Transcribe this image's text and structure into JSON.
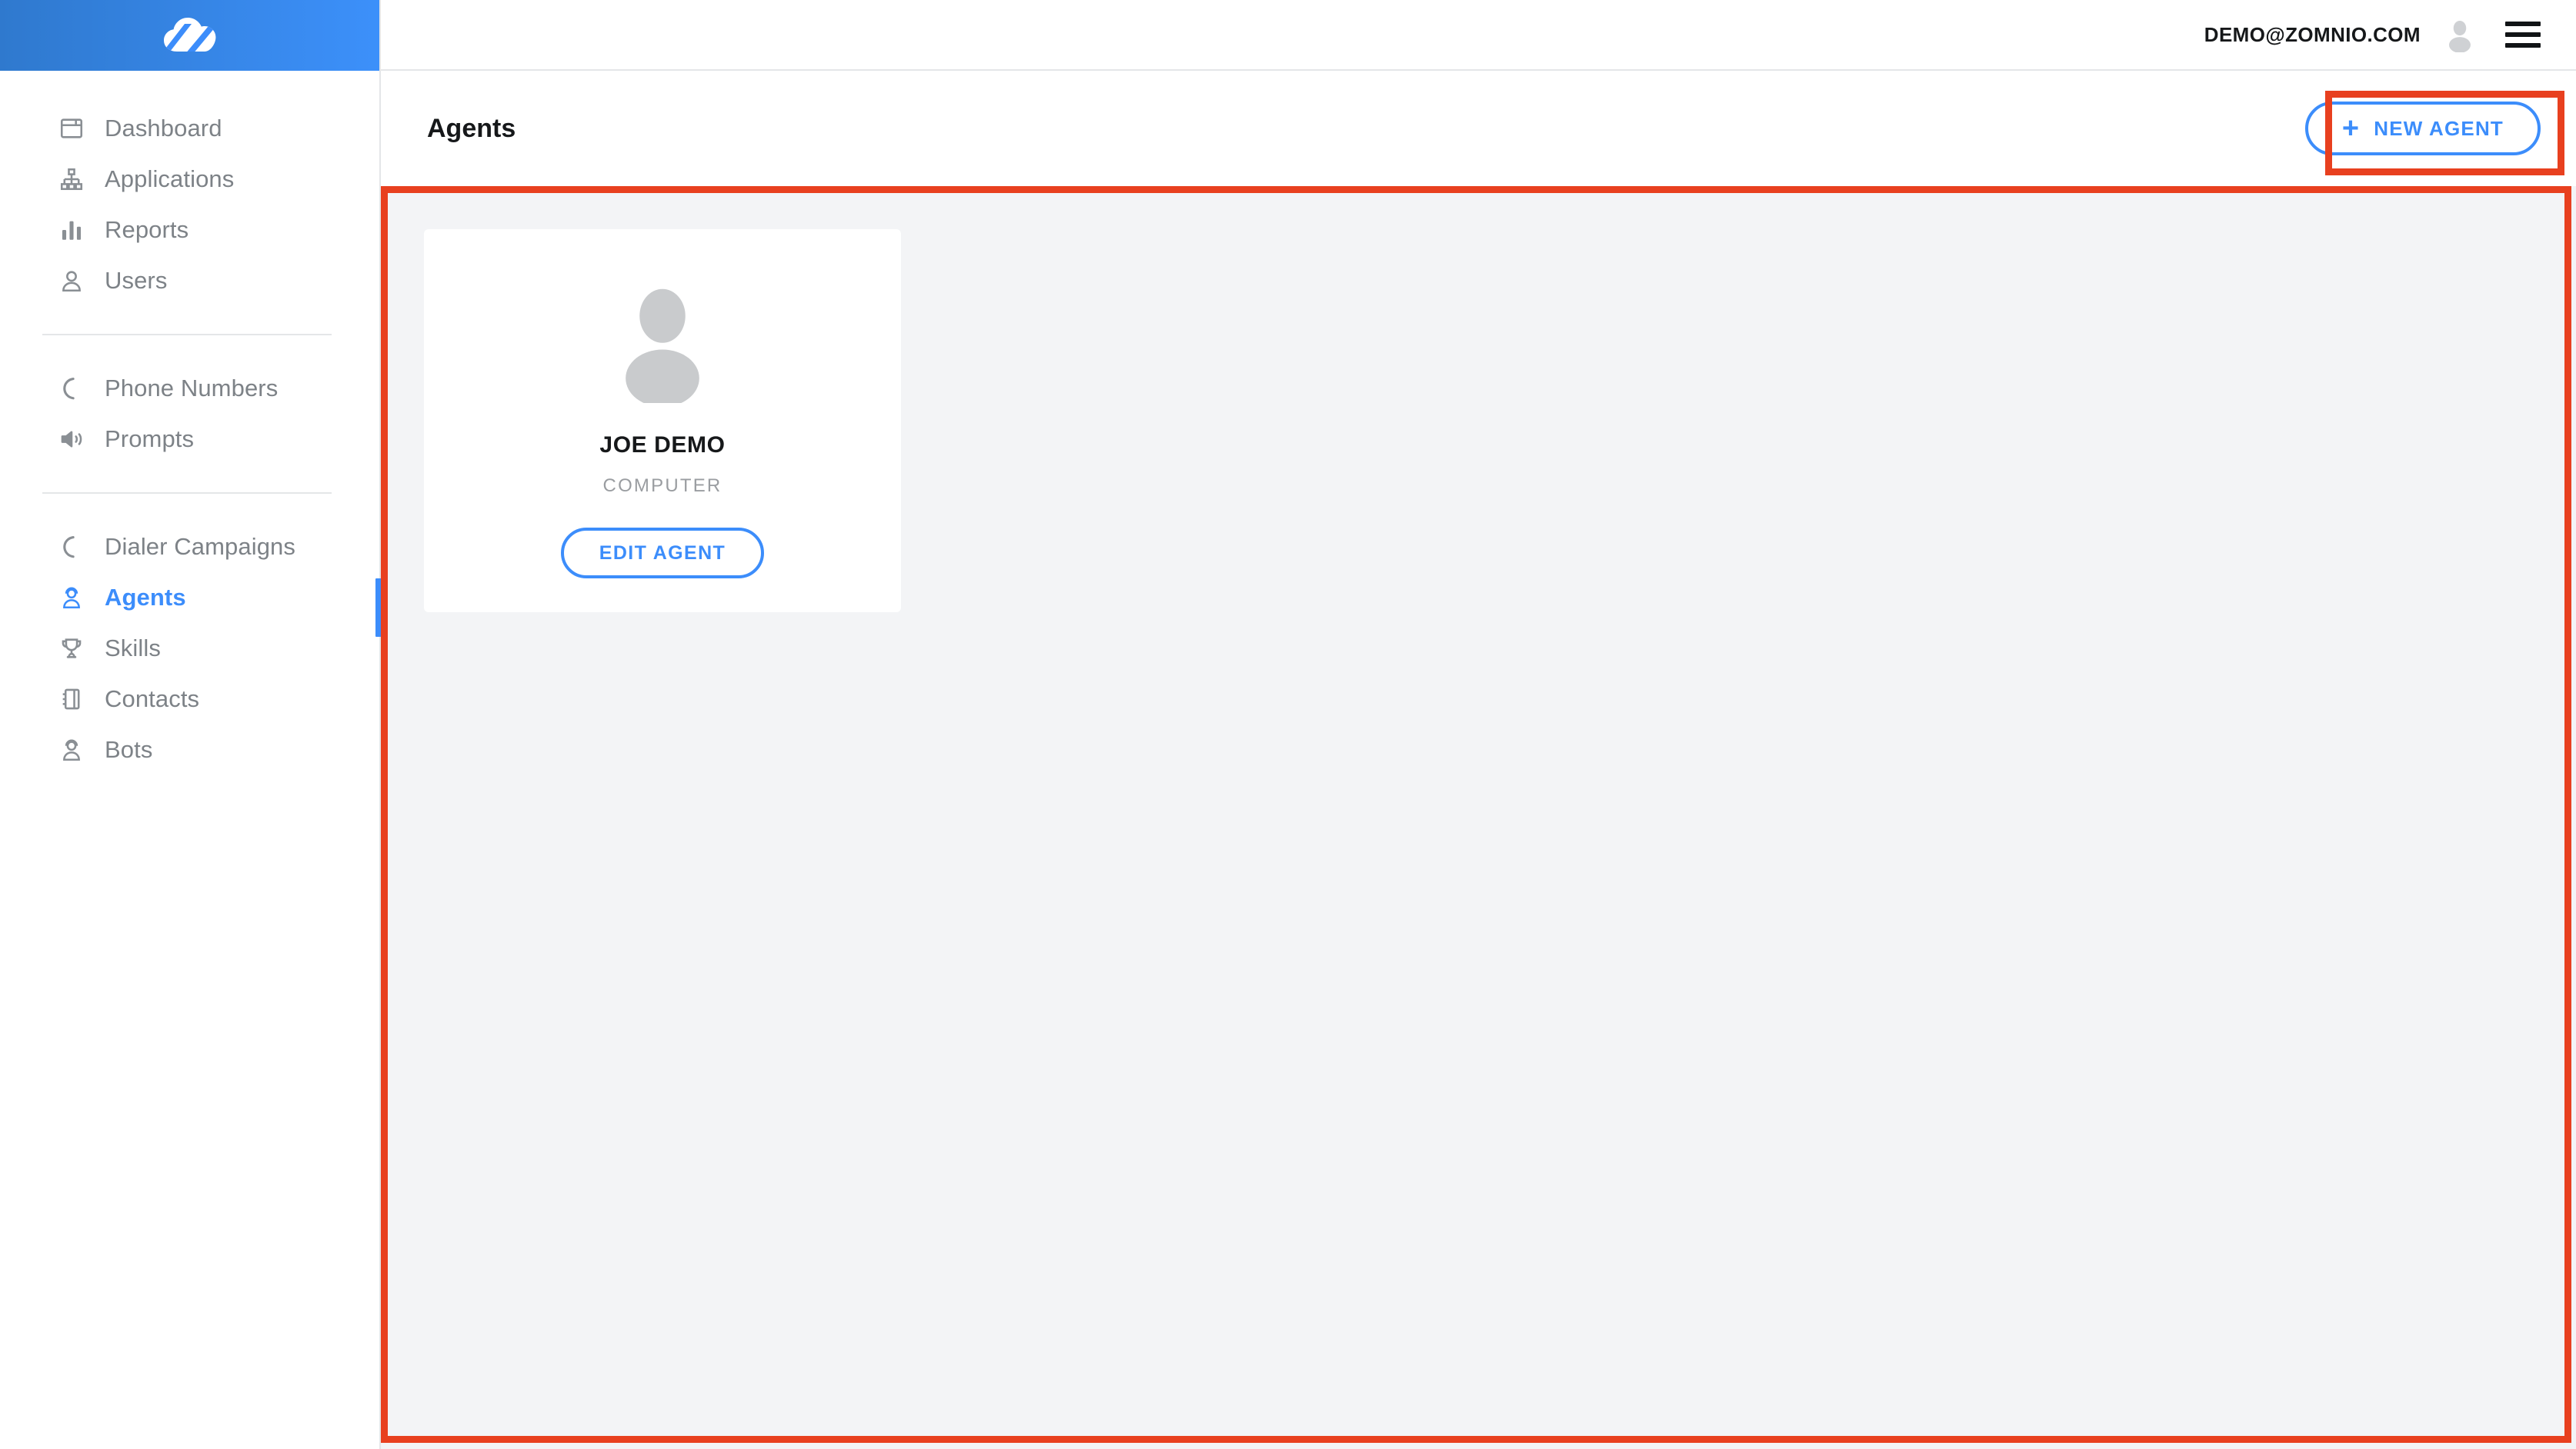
{
  "brand": {
    "logo_icon": "cloud-swoosh-logo",
    "gradient_from": "#2f79ce",
    "gradient_to": "#3c90fa"
  },
  "colors": {
    "accent_blue": "#3c8dfb",
    "annotation_red": "#e8401f",
    "content_bg": "#f3f4f6",
    "muted_text": "#7d8287"
  },
  "topbar": {
    "user_email": "DEMO@ZOMNIO.COM",
    "avatar_icon": "user-avatar-icon",
    "menu_icon": "hamburger-menu-icon"
  },
  "sidebar": {
    "groups": [
      {
        "items": [
          {
            "label": "Dashboard",
            "icon": "dashboard-window-icon",
            "active": false
          },
          {
            "label": "Applications",
            "icon": "sitemap-icon",
            "active": false
          },
          {
            "label": "Reports",
            "icon": "bar-chart-icon",
            "active": false
          },
          {
            "label": "Users",
            "icon": "user-icon",
            "active": false
          }
        ]
      },
      {
        "items": [
          {
            "label": "Phone Numbers",
            "icon": "phone-icon",
            "active": false
          },
          {
            "label": "Prompts",
            "icon": "speaker-icon",
            "active": false
          }
        ]
      },
      {
        "items": [
          {
            "label": "Dialer Campaigns",
            "icon": "phone-icon",
            "active": false
          },
          {
            "label": "Agents",
            "icon": "headset-agent-icon",
            "active": true
          },
          {
            "label": "Skills",
            "icon": "trophy-icon",
            "active": false
          },
          {
            "label": "Contacts",
            "icon": "address-book-icon",
            "active": false
          },
          {
            "label": "Bots",
            "icon": "bot-headset-icon",
            "active": false
          }
        ]
      }
    ]
  },
  "page": {
    "title": "Agents",
    "new_agent_button": {
      "label": "NEW AGENT",
      "plus": "+",
      "icon": "plus-icon"
    }
  },
  "agents": [
    {
      "name": "JOE DEMO",
      "role": "COMPUTER",
      "avatar_icon": "agent-avatar-icon",
      "edit_label": "EDIT AGENT"
    }
  ]
}
